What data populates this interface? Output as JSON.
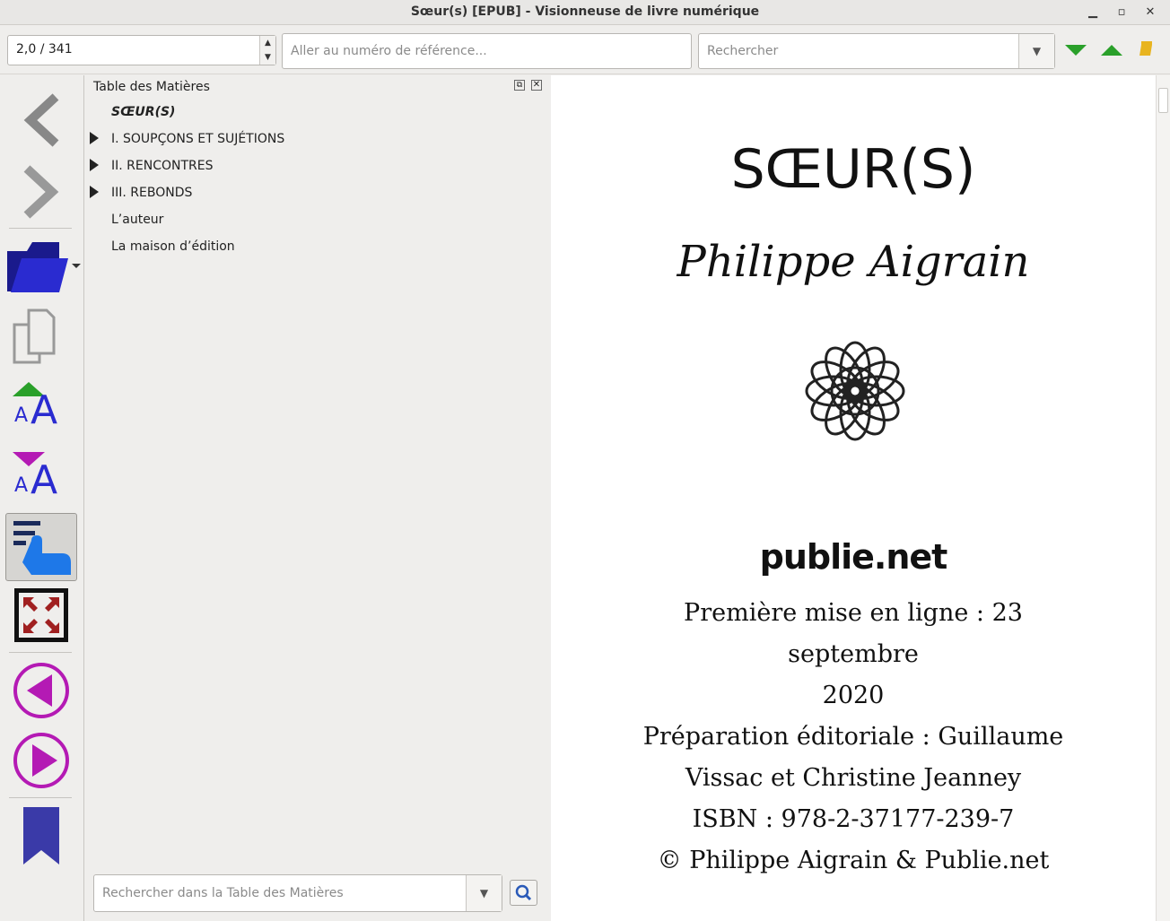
{
  "window": {
    "title": "Sœur(s) [EPUB] - Visionneuse de livre numérique"
  },
  "toolbar": {
    "position_value": "2,0 / 341",
    "goto_placeholder": "Aller au numéro de référence...",
    "search_placeholder": "Rechercher"
  },
  "left_toolbar": {
    "icons": [
      "back-icon",
      "forward-icon",
      "open-folder-icon",
      "copy-icon",
      "font-larger-icon",
      "font-smaller-icon",
      "toc-icon",
      "fullscreen-icon",
      "previous-icon",
      "next-icon",
      "bookmark-icon"
    ]
  },
  "toc": {
    "title": "Table des Matières",
    "items": [
      {
        "label": "SŒUR(S)",
        "expandable": false,
        "current": true
      },
      {
        "label": "I. SOUPÇONS ET SUJÉTIONS",
        "expandable": true
      },
      {
        "label": "II. RENCONTRES",
        "expandable": true
      },
      {
        "label": "III. REBONDS",
        "expandable": true
      },
      {
        "label": "L’auteur",
        "expandable": false
      },
      {
        "label": "La maison d’édition",
        "expandable": false
      }
    ],
    "search_placeholder": "Rechercher dans la Table des Matières"
  },
  "book": {
    "title": "SŒUR(S)",
    "author": "Philippe Aigrain",
    "publisher": "publie.net",
    "credits": [
      "Première mise en ligne : 23 septembre",
      "2020",
      "Préparation éditoriale : Guillaume",
      "Vissac et Christine Jeanney",
      "ISBN : 978-2-37177-239-7",
      "© Philippe Aigrain & Publie.net"
    ]
  },
  "colors": {
    "accent_blue": "#2a2bd0",
    "magenta": "#b41ab4",
    "green": "#2aa02a",
    "bookmark": "#3a3aa8"
  }
}
